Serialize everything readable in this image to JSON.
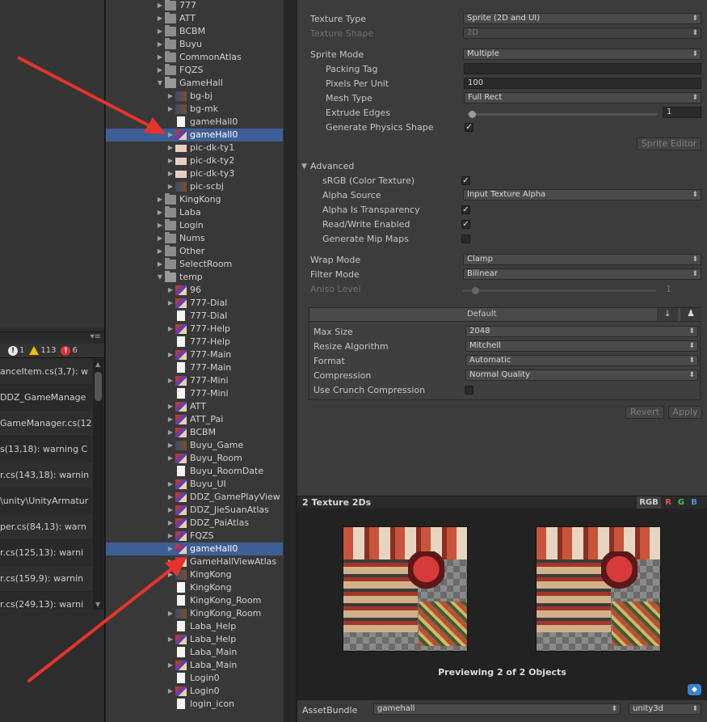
{
  "console": {
    "counters": {
      "info": "1",
      "warnings": "113",
      "errors": "6"
    },
    "rows": [
      "anceItem.cs(3,7): w",
      "DDZ_GameManage",
      "GameManager.cs(12",
      "s(13,18): warning C",
      "r.cs(143,18): warnin",
      "\\unity\\UnityArmatur",
      "per.cs(84,13): warn",
      "r.cs(125,13): warni",
      "r.cs(159,9): warnin",
      "r.cs(249,13): warni"
    ]
  },
  "tree": {
    "rows": [
      {
        "label": "777",
        "icon": "folder-icon",
        "indent": 0,
        "arrow": "collapsed"
      },
      {
        "label": "ATT",
        "icon": "folder-icon",
        "indent": 0,
        "arrow": "collapsed"
      },
      {
        "label": "BCBM",
        "icon": "folder-icon",
        "indent": 0,
        "arrow": "collapsed"
      },
      {
        "label": "Buyu",
        "icon": "folder-icon",
        "indent": 0,
        "arrow": "collapsed"
      },
      {
        "label": "CommonAtlas",
        "icon": "folder-icon",
        "indent": 0,
        "arrow": "collapsed"
      },
      {
        "label": "FQZS",
        "icon": "folder-icon",
        "indent": 0,
        "arrow": "collapsed"
      },
      {
        "label": "GameHall",
        "icon": "folder-open-icon",
        "indent": 0,
        "arrow": "expanded"
      },
      {
        "label": "bg-bj",
        "icon": "dark-texture-icon",
        "indent": 1,
        "arrow": "collapsed"
      },
      {
        "label": "bg-mk",
        "icon": "dark-texture-icon",
        "indent": 1,
        "arrow": "collapsed"
      },
      {
        "label": "gameHall0",
        "icon": "file-icon",
        "indent": 1,
        "arrow": "none"
      },
      {
        "label": "gameHall0",
        "icon": "texture-icon",
        "indent": 1,
        "arrow": "collapsed",
        "selected": true
      },
      {
        "label": "pic-dk-ty1",
        "icon": "bar-texture-icon",
        "indent": 1,
        "arrow": "collapsed"
      },
      {
        "label": "pic-dk-ty2",
        "icon": "bar-texture-icon",
        "indent": 1,
        "arrow": "collapsed"
      },
      {
        "label": "pic-dk-ty3",
        "icon": "bar-texture-icon",
        "indent": 1,
        "arrow": "collapsed"
      },
      {
        "label": "pic-scbj",
        "icon": "dark-texture-icon",
        "indent": 1,
        "arrow": "collapsed"
      },
      {
        "label": "KingKong",
        "icon": "folder-icon",
        "indent": 0,
        "arrow": "collapsed"
      },
      {
        "label": "Laba",
        "icon": "folder-icon",
        "indent": 0,
        "arrow": "collapsed"
      },
      {
        "label": "Login",
        "icon": "folder-icon",
        "indent": 0,
        "arrow": "collapsed"
      },
      {
        "label": "Nums",
        "icon": "folder-icon",
        "indent": 0,
        "arrow": "collapsed"
      },
      {
        "label": "Other",
        "icon": "folder-icon",
        "indent": 0,
        "arrow": "collapsed"
      },
      {
        "label": "SelectRoom",
        "icon": "folder-icon",
        "indent": 0,
        "arrow": "collapsed"
      },
      {
        "label": "temp",
        "icon": "folder-open-icon",
        "indent": 0,
        "arrow": "expanded"
      },
      {
        "label": "96",
        "icon": "texture-icon",
        "indent": 1,
        "arrow": "collapsed"
      },
      {
        "label": "777-Dial",
        "icon": "texture-icon",
        "indent": 1,
        "arrow": "collapsed"
      },
      {
        "label": "777-Dial",
        "icon": "file-icon",
        "indent": 1,
        "arrow": "none"
      },
      {
        "label": "777-Help",
        "icon": "texture-icon",
        "indent": 1,
        "arrow": "collapsed"
      },
      {
        "label": "777-Help",
        "icon": "file-icon",
        "indent": 1,
        "arrow": "none"
      },
      {
        "label": "777-Main",
        "icon": "texture-icon",
        "indent": 1,
        "arrow": "collapsed"
      },
      {
        "label": "777-Main",
        "icon": "file-icon",
        "indent": 1,
        "arrow": "none"
      },
      {
        "label": "777-Mini",
        "icon": "texture-icon",
        "indent": 1,
        "arrow": "collapsed"
      },
      {
        "label": "777-Mini",
        "icon": "file-icon",
        "indent": 1,
        "arrow": "none"
      },
      {
        "label": "ATT",
        "icon": "texture-icon",
        "indent": 1,
        "arrow": "collapsed"
      },
      {
        "label": "ATT_Pai",
        "icon": "texture-icon",
        "indent": 1,
        "arrow": "collapsed"
      },
      {
        "label": "BCBM",
        "icon": "texture-icon",
        "indent": 1,
        "arrow": "collapsed"
      },
      {
        "label": "Buyu_Game",
        "icon": "dark-texture-icon",
        "indent": 1,
        "arrow": "collapsed"
      },
      {
        "label": "Buyu_Room",
        "icon": "texture-icon",
        "indent": 1,
        "arrow": "collapsed"
      },
      {
        "label": "Buyu_RoomDate",
        "icon": "file-icon",
        "indent": 1,
        "arrow": "none"
      },
      {
        "label": "Buyu_UI",
        "icon": "texture-icon",
        "indent": 1,
        "arrow": "collapsed"
      },
      {
        "label": "DDZ_GamePlayView",
        "icon": "texture-icon",
        "indent": 1,
        "arrow": "collapsed"
      },
      {
        "label": "DDZ_JieSuanAtlas",
        "icon": "texture-icon",
        "indent": 1,
        "arrow": "collapsed"
      },
      {
        "label": "DDZ_PaiAtlas",
        "icon": "texture-icon",
        "indent": 1,
        "arrow": "collapsed"
      },
      {
        "label": "FQZS",
        "icon": "texture-icon",
        "indent": 1,
        "arrow": "collapsed"
      },
      {
        "label": "gameHall0",
        "icon": "texture-icon",
        "indent": 1,
        "arrow": "collapsed",
        "selected": true
      },
      {
        "label": "GameHallViewAtlas",
        "icon": "texture-icon",
        "indent": 1,
        "arrow": "collapsed"
      },
      {
        "label": "KingKong",
        "icon": "dark-texture-icon",
        "indent": 1,
        "arrow": "collapsed"
      },
      {
        "label": "KingKong",
        "icon": "file-icon",
        "indent": 1,
        "arrow": "none"
      },
      {
        "label": "KingKong_Room",
        "icon": "file-icon",
        "indent": 1,
        "arrow": "none"
      },
      {
        "label": "KingKong_Room",
        "icon": "dark-texture-icon",
        "indent": 1,
        "arrow": "collapsed"
      },
      {
        "label": "Laba_Help",
        "icon": "file-icon",
        "indent": 1,
        "arrow": "none"
      },
      {
        "label": "Laba_Help",
        "icon": "texture-icon",
        "indent": 1,
        "arrow": "collapsed"
      },
      {
        "label": "Laba_Main",
        "icon": "file-icon",
        "indent": 1,
        "arrow": "none"
      },
      {
        "label": "Laba_Main",
        "icon": "texture-icon",
        "indent": 1,
        "arrow": "collapsed"
      },
      {
        "label": "Login0",
        "icon": "file-icon",
        "indent": 1,
        "arrow": "none"
      },
      {
        "label": "Login0",
        "icon": "texture-icon",
        "indent": 1,
        "arrow": "collapsed"
      },
      {
        "label": "login_icon",
        "icon": "file-icon",
        "indent": 1,
        "arrow": "none"
      }
    ]
  },
  "inspector": {
    "texture_type": {
      "label": "Texture Type",
      "value": "Sprite (2D and UI)"
    },
    "texture_shape": {
      "label": "Texture Shape",
      "value": "2D"
    },
    "sprite_mode": {
      "label": "Sprite Mode",
      "value": "Multiple"
    },
    "packing_tag": {
      "label": "Packing Tag",
      "value": ""
    },
    "pixels_per_unit": {
      "label": "Pixels Per Unit",
      "value": "100"
    },
    "mesh_type": {
      "label": "Mesh Type",
      "value": "Full Rect"
    },
    "extrude_edges": {
      "label": "Extrude Edges",
      "value": "1"
    },
    "generate_physics_shape": {
      "label": "Generate Physics Shape",
      "checked": true
    },
    "sprite_editor_button": "Sprite Editor",
    "advanced": {
      "label": "Advanced",
      "srgb": {
        "label": "sRGB (Color Texture)",
        "checked": true
      },
      "alpha_source": {
        "label": "Alpha Source",
        "value": "Input Texture Alpha"
      },
      "alpha_is_transparency": {
        "label": "Alpha Is Transparency",
        "checked": true
      },
      "read_write": {
        "label": "Read/Write Enabled",
        "checked": true
      },
      "mip_maps": {
        "label": "Generate Mip Maps",
        "checked": false
      }
    },
    "wrap_mode": {
      "label": "Wrap Mode",
      "value": "Clamp"
    },
    "filter_mode": {
      "label": "Filter Mode",
      "value": "Bilinear"
    },
    "aniso_level": {
      "label": "Aniso Level",
      "value": "1"
    },
    "platform": {
      "tab": "Default",
      "max_size": {
        "label": "Max Size",
        "value": "2048"
      },
      "resize_algorithm": {
        "label": "Resize Algorithm",
        "value": "Mitchell"
      },
      "format": {
        "label": "Format",
        "value": "Automatic"
      },
      "compression": {
        "label": "Compression",
        "value": "Normal Quality"
      },
      "crunch": {
        "label": "Use Crunch Compression",
        "checked": false
      }
    },
    "revert_button": "Revert",
    "apply_button": "Apply"
  },
  "preview": {
    "title": "2 Texture 2Ds",
    "channels": [
      "RGB",
      "R",
      "G",
      "B"
    ],
    "channel_colors": [
      "#cfcfcf",
      "#e05050",
      "#50c050",
      "#5090e0"
    ],
    "caption": "Previewing 2 of 2 Objects"
  },
  "asset_bundle": {
    "label": "AssetBundle",
    "name": "gamehall",
    "variant": "unity3d"
  }
}
